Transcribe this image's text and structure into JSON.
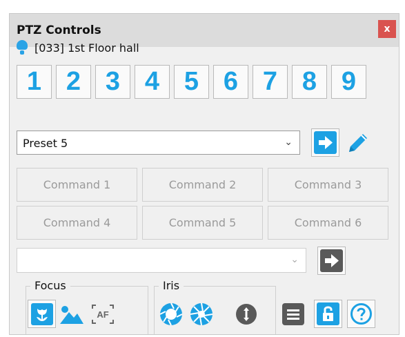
{
  "window": {
    "title": "PTZ Controls",
    "close_glyph": "x"
  },
  "camera": {
    "label": "[033] 1st Floor hall",
    "icon": "camera-icon"
  },
  "presets_quick": [
    "1",
    "2",
    "3",
    "4",
    "5",
    "6",
    "7",
    "8",
    "9"
  ],
  "preset": {
    "selected": "Preset 5",
    "caret": "⌄",
    "go_icon": "arrow-right-icon",
    "edit_icon": "pencil-icon"
  },
  "commands": [
    "Command 1",
    "Command 2",
    "Command 3",
    "Command 4",
    "Command 5",
    "Command 6"
  ],
  "sequence": {
    "selected": "",
    "caret": "⌄",
    "go_icon": "arrow-right-icon"
  },
  "focus": {
    "label": "Focus",
    "buttons": [
      "macro-icon",
      "landscape-icon",
      "autofocus-icon"
    ],
    "af_text": "AF"
  },
  "iris": {
    "label": "Iris",
    "buttons": [
      "iris-open-icon",
      "iris-close-icon",
      "iris-auto-icon"
    ]
  },
  "extra_buttons": [
    "menu-icon",
    "lock-icon",
    "help-icon"
  ],
  "colors": {
    "accent": "#1da1e3",
    "close": "#d9534f",
    "disabled_text": "#9a9a9a"
  }
}
